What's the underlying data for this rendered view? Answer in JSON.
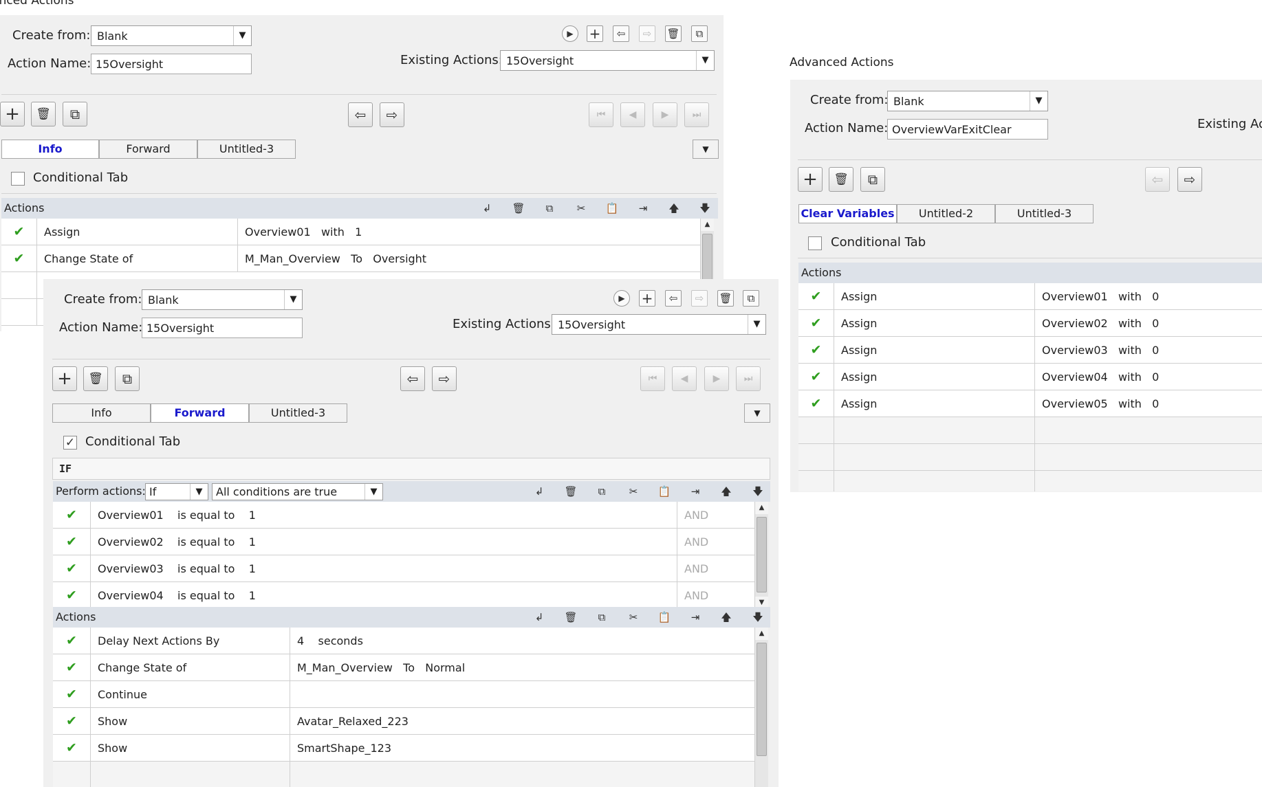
{
  "window_title": "Advanced Actions",
  "labels": {
    "create_from": "Create from:",
    "action_name": "Action Name:",
    "existing_actions": "Existing Actions:",
    "existing_actions_partial": "Existing Ac",
    "conditional_tab": "Conditional Tab",
    "actions": "Actions",
    "if": "IF",
    "perform_actions": "Perform actions:"
  },
  "panel_a": {
    "title": "Advanced Actions",
    "create_from": "Blank",
    "action_name": "15Oversight",
    "existing_action": "15Oversight",
    "tabs": [
      "Info",
      "Forward",
      "Untitled-3"
    ],
    "active_tab": "Info",
    "conditional_checked": false,
    "actions": [
      {
        "name": "Assign",
        "detail": "Overview01   with   1"
      },
      {
        "name": "Change State of",
        "detail": "M_Man_Overview   To   Oversight"
      }
    ]
  },
  "panel_b": {
    "create_from": "Blank",
    "action_name": "15Oversight",
    "existing_action": "15Oversight",
    "tabs": [
      "Info",
      "Forward",
      "Untitled-3"
    ],
    "active_tab": "Forward",
    "conditional_checked": true,
    "perform_mode": "If",
    "condition_mode": "All conditions are true",
    "conditions": [
      {
        "text": "Overview01    is equal to    1",
        "op": "AND"
      },
      {
        "text": "Overview02    is equal to    1",
        "op": "AND"
      },
      {
        "text": "Overview03    is equal to    1",
        "op": "AND"
      },
      {
        "text": "Overview04    is equal to    1",
        "op": "AND"
      }
    ],
    "actions": [
      {
        "name": "Delay Next Actions By",
        "detail": "4    seconds"
      },
      {
        "name": "Change State of",
        "detail": "M_Man_Overview   To   Normal"
      },
      {
        "name": "Continue",
        "detail": ""
      },
      {
        "name": "Show",
        "detail": "Avatar_Relaxed_223"
      },
      {
        "name": "Show",
        "detail": "SmartShape_123"
      }
    ]
  },
  "panel_c": {
    "title": "Advanced Actions",
    "create_from": "Blank",
    "action_name": "OverviewVarExitClear",
    "tabs": [
      "Clear Variables",
      "Untitled-2",
      "Untitled-3"
    ],
    "active_tab": "Clear Variables",
    "conditional_checked": false,
    "actions": [
      {
        "name": "Assign",
        "detail": "Overview01   with   0"
      },
      {
        "name": "Assign",
        "detail": "Overview02   with   0"
      },
      {
        "name": "Assign",
        "detail": "Overview03   with   0"
      },
      {
        "name": "Assign",
        "detail": "Overview04   with   0"
      },
      {
        "name": "Assign",
        "detail": "Overview05   with   0"
      }
    ]
  },
  "glyphs": {
    "check": "✔",
    "checkbox_checked": "✓",
    "dropdown_arrow": "▼",
    "scroll_up": "▲",
    "scroll_down": "▼",
    "grip": "≡"
  },
  "icons": {
    "play": "▶",
    "add": "+",
    "trash": "🗑",
    "copy": "⧉",
    "duplicate": "⧉",
    "import": "⇦",
    "export": "⇨",
    "first": "⏮",
    "prev": "◀",
    "next": "▶",
    "last": "⏭",
    "insert": "↲",
    "cut": "✂",
    "paste": "📋",
    "indent": "⇥",
    "move_up": "🡅",
    "move_down": "🡇"
  }
}
